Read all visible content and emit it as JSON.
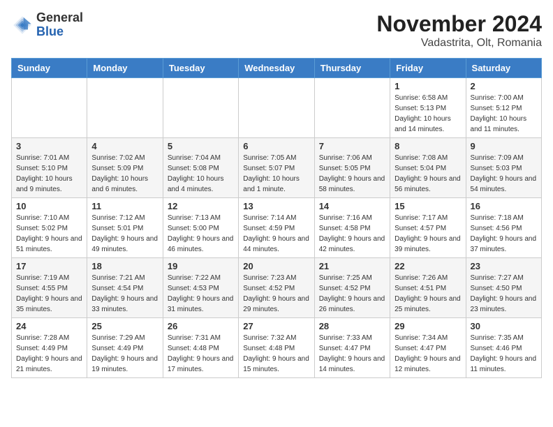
{
  "logo": {
    "text_general": "General",
    "text_blue": "Blue"
  },
  "title": "November 2024",
  "location": "Vadastrita, Olt, Romania",
  "days_of_week": [
    "Sunday",
    "Monday",
    "Tuesday",
    "Wednesday",
    "Thursday",
    "Friday",
    "Saturday"
  ],
  "weeks": [
    [
      {
        "day": "",
        "info": ""
      },
      {
        "day": "",
        "info": ""
      },
      {
        "day": "",
        "info": ""
      },
      {
        "day": "",
        "info": ""
      },
      {
        "day": "",
        "info": ""
      },
      {
        "day": "1",
        "info": "Sunrise: 6:58 AM\nSunset: 5:13 PM\nDaylight: 10 hours and 14 minutes."
      },
      {
        "day": "2",
        "info": "Sunrise: 7:00 AM\nSunset: 5:12 PM\nDaylight: 10 hours and 11 minutes."
      }
    ],
    [
      {
        "day": "3",
        "info": "Sunrise: 7:01 AM\nSunset: 5:10 PM\nDaylight: 10 hours and 9 minutes."
      },
      {
        "day": "4",
        "info": "Sunrise: 7:02 AM\nSunset: 5:09 PM\nDaylight: 10 hours and 6 minutes."
      },
      {
        "day": "5",
        "info": "Sunrise: 7:04 AM\nSunset: 5:08 PM\nDaylight: 10 hours and 4 minutes."
      },
      {
        "day": "6",
        "info": "Sunrise: 7:05 AM\nSunset: 5:07 PM\nDaylight: 10 hours and 1 minute."
      },
      {
        "day": "7",
        "info": "Sunrise: 7:06 AM\nSunset: 5:05 PM\nDaylight: 9 hours and 58 minutes."
      },
      {
        "day": "8",
        "info": "Sunrise: 7:08 AM\nSunset: 5:04 PM\nDaylight: 9 hours and 56 minutes."
      },
      {
        "day": "9",
        "info": "Sunrise: 7:09 AM\nSunset: 5:03 PM\nDaylight: 9 hours and 54 minutes."
      }
    ],
    [
      {
        "day": "10",
        "info": "Sunrise: 7:10 AM\nSunset: 5:02 PM\nDaylight: 9 hours and 51 minutes."
      },
      {
        "day": "11",
        "info": "Sunrise: 7:12 AM\nSunset: 5:01 PM\nDaylight: 9 hours and 49 minutes."
      },
      {
        "day": "12",
        "info": "Sunrise: 7:13 AM\nSunset: 5:00 PM\nDaylight: 9 hours and 46 minutes."
      },
      {
        "day": "13",
        "info": "Sunrise: 7:14 AM\nSunset: 4:59 PM\nDaylight: 9 hours and 44 minutes."
      },
      {
        "day": "14",
        "info": "Sunrise: 7:16 AM\nSunset: 4:58 PM\nDaylight: 9 hours and 42 minutes."
      },
      {
        "day": "15",
        "info": "Sunrise: 7:17 AM\nSunset: 4:57 PM\nDaylight: 9 hours and 39 minutes."
      },
      {
        "day": "16",
        "info": "Sunrise: 7:18 AM\nSunset: 4:56 PM\nDaylight: 9 hours and 37 minutes."
      }
    ],
    [
      {
        "day": "17",
        "info": "Sunrise: 7:19 AM\nSunset: 4:55 PM\nDaylight: 9 hours and 35 minutes."
      },
      {
        "day": "18",
        "info": "Sunrise: 7:21 AM\nSunset: 4:54 PM\nDaylight: 9 hours and 33 minutes."
      },
      {
        "day": "19",
        "info": "Sunrise: 7:22 AM\nSunset: 4:53 PM\nDaylight: 9 hours and 31 minutes."
      },
      {
        "day": "20",
        "info": "Sunrise: 7:23 AM\nSunset: 4:52 PM\nDaylight: 9 hours and 29 minutes."
      },
      {
        "day": "21",
        "info": "Sunrise: 7:25 AM\nSunset: 4:52 PM\nDaylight: 9 hours and 26 minutes."
      },
      {
        "day": "22",
        "info": "Sunrise: 7:26 AM\nSunset: 4:51 PM\nDaylight: 9 hours and 25 minutes."
      },
      {
        "day": "23",
        "info": "Sunrise: 7:27 AM\nSunset: 4:50 PM\nDaylight: 9 hours and 23 minutes."
      }
    ],
    [
      {
        "day": "24",
        "info": "Sunrise: 7:28 AM\nSunset: 4:49 PM\nDaylight: 9 hours and 21 minutes."
      },
      {
        "day": "25",
        "info": "Sunrise: 7:29 AM\nSunset: 4:49 PM\nDaylight: 9 hours and 19 minutes."
      },
      {
        "day": "26",
        "info": "Sunrise: 7:31 AM\nSunset: 4:48 PM\nDaylight: 9 hours and 17 minutes."
      },
      {
        "day": "27",
        "info": "Sunrise: 7:32 AM\nSunset: 4:48 PM\nDaylight: 9 hours and 15 minutes."
      },
      {
        "day": "28",
        "info": "Sunrise: 7:33 AM\nSunset: 4:47 PM\nDaylight: 9 hours and 14 minutes."
      },
      {
        "day": "29",
        "info": "Sunrise: 7:34 AM\nSunset: 4:47 PM\nDaylight: 9 hours and 12 minutes."
      },
      {
        "day": "30",
        "info": "Sunrise: 7:35 AM\nSunset: 4:46 PM\nDaylight: 9 hours and 11 minutes."
      }
    ]
  ]
}
